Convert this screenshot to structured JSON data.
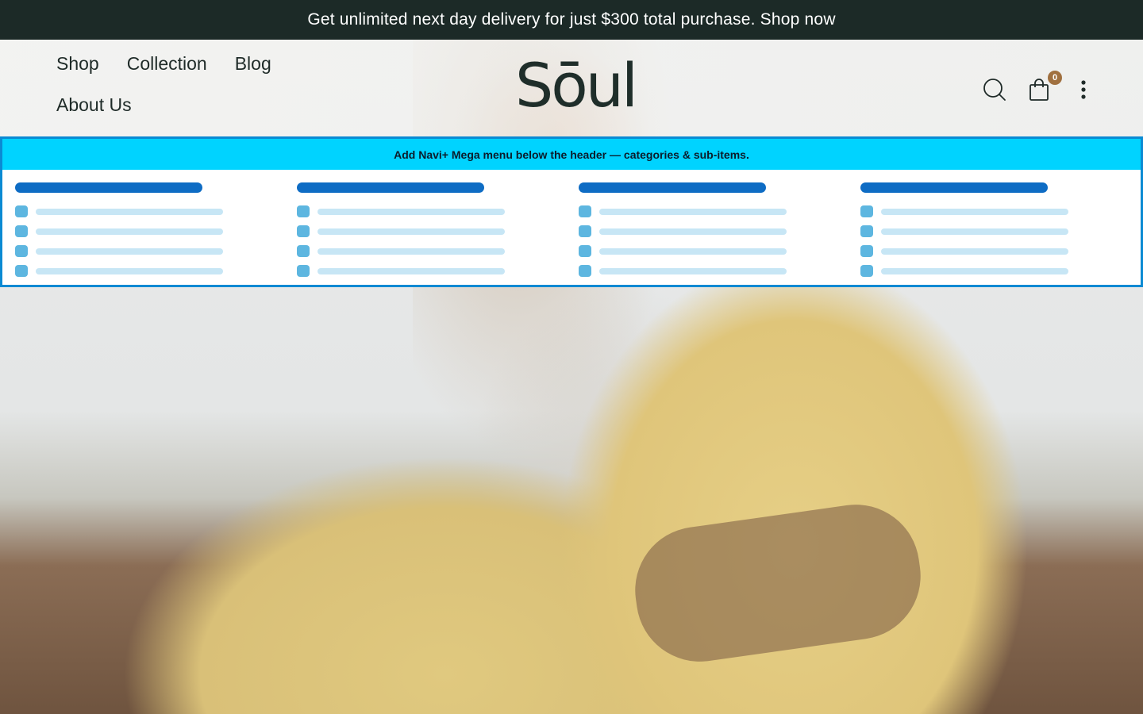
{
  "announcement": {
    "text": "Get unlimited next day delivery for just $300 total purchase. Shop now"
  },
  "header": {
    "nav": [
      {
        "label": "Shop"
      },
      {
        "label": "Collection"
      },
      {
        "label": "Blog"
      },
      {
        "label": "About Us"
      }
    ],
    "logo": "Sōul",
    "icons": [
      "search-icon",
      "cart-icon",
      "more-vertical-icon"
    ],
    "cart_count": "0"
  },
  "mega_menu": {
    "banner_text": "Add Navi+ Mega menu below the header — categories & sub-items.",
    "columns": [
      {
        "items": 4
      },
      {
        "items": 4
      },
      {
        "items": 4
      },
      {
        "items": 4
      }
    ]
  },
  "colors": {
    "announcement_bg": "#1c2a27",
    "banner_bg": "#00d3ff",
    "banner_border": "#0b8ad3",
    "placeholder_head": "#0e6cc4",
    "cart_badge": "#a0703f"
  }
}
